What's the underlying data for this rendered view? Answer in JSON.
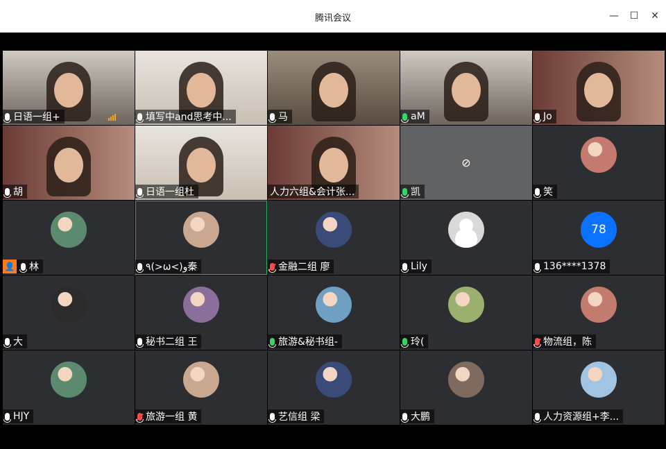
{
  "window": {
    "title": "腾讯会议"
  },
  "participants": [
    {
      "name": "日语一组+",
      "tile": "video",
      "v": "v4",
      "mic": "normal"
    },
    {
      "name": "填写中and思考中...",
      "tile": "video",
      "v": "v2",
      "mic": "normal"
    },
    {
      "name": "马",
      "tile": "video",
      "v": "v3",
      "mic": "normal"
    },
    {
      "name": "aM",
      "tile": "video",
      "v": "v4",
      "mic": "green"
    },
    {
      "name": "Jo",
      "tile": "video",
      "v": "v5",
      "mic": "normal"
    },
    {
      "name": "胡",
      "tile": "video",
      "v": "v5",
      "mic": "normal"
    },
    {
      "name": "日语一组杜",
      "tile": "video",
      "v": "v2",
      "mic": "normal"
    },
    {
      "name": "人力六组&会计张...",
      "tile": "video",
      "v": "v5",
      "mic": "none"
    },
    {
      "name": "凯",
      "tile": "off",
      "mic": "green"
    },
    {
      "name": "笑",
      "tile": "avatar",
      "avatar": "photo",
      "mic": "normal"
    },
    {
      "name": "林",
      "tile": "avatar",
      "avatar": "photo",
      "mic": "normal",
      "host": true
    },
    {
      "name": "٩(>ω<)و秦",
      "tile": "avatar",
      "avatar": "photo",
      "mic": "normal",
      "active": true
    },
    {
      "name": "金融二组 廖",
      "tile": "avatar",
      "avatar": "photo",
      "mic": "muted"
    },
    {
      "name": "Lily",
      "tile": "avatar",
      "avatar": "gray",
      "mic": "normal"
    },
    {
      "name": "136****1378",
      "tile": "avatar",
      "avatar": "num",
      "avatar_text": "78",
      "mic": "normal"
    },
    {
      "name": "大",
      "tile": "avatar",
      "avatar": "photo",
      "mic": "normal"
    },
    {
      "name": "秘书二组 王",
      "tile": "avatar",
      "avatar": "photo",
      "mic": "normal"
    },
    {
      "name": "旅游&秘书组-",
      "tile": "avatar",
      "avatar": "photo",
      "mic": "green"
    },
    {
      "name": "玲(",
      "tile": "avatar",
      "avatar": "photo",
      "mic": "green"
    },
    {
      "name": "物流组，陈",
      "tile": "avatar",
      "avatar": "photo",
      "mic": "muted"
    },
    {
      "name": "HJY",
      "tile": "avatar",
      "avatar": "photo",
      "mic": "normal"
    },
    {
      "name": "旅游一组 黄",
      "tile": "avatar",
      "avatar": "photo",
      "mic": "muted"
    },
    {
      "name": "艺信组 梁",
      "tile": "avatar",
      "avatar": "photo",
      "mic": "normal"
    },
    {
      "name": "大鹏",
      "tile": "avatar",
      "avatar": "photo",
      "mic": "normal"
    },
    {
      "name": "人力资源组+李...",
      "tile": "avatar",
      "avatar": "photo",
      "mic": "normal"
    }
  ],
  "colors": {
    "host_badge": "#ff7a1b",
    "active_border": "#1fb56c",
    "muted": "#ff4a4a",
    "speaking": "#3ad36b"
  }
}
